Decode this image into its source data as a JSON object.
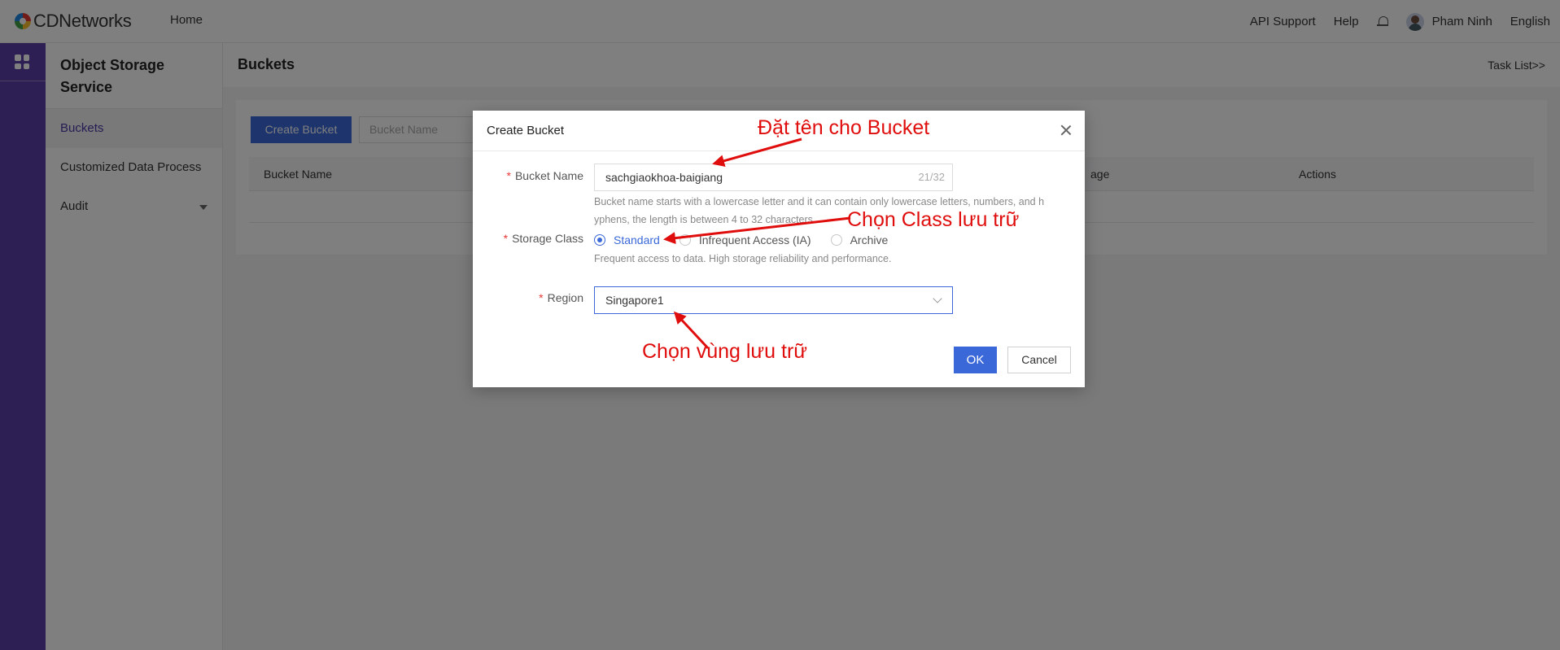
{
  "topbar": {
    "logo_text": "CDNetworks",
    "home_label": "Home",
    "api_support": "API Support",
    "help": "Help",
    "user_name": "Pham Ninh",
    "language": "English"
  },
  "sidebar": {
    "title": "Object Storage Service",
    "items": [
      {
        "label": "Buckets"
      },
      {
        "label": "Customized Data Process"
      },
      {
        "label": "Audit"
      }
    ]
  },
  "main": {
    "title": "Buckets",
    "task_list": "Task List>>",
    "create_bucket_label": "Create Bucket",
    "search_placeholder": "Bucket Name",
    "columns": {
      "bucket_name": "Bucket Name",
      "storage_partial": "age",
      "actions": "Actions"
    }
  },
  "modal": {
    "title": "Create Bucket",
    "bucket_name_label": "Bucket Name",
    "bucket_name_value": "sachgiaokhoa-baigiang",
    "bucket_name_counter": "21/32",
    "bucket_name_hint_1": "Bucket name starts with a lowercase letter and it can contain only lowercase letters, numbers, and h",
    "bucket_name_hint_2": "yphens, the length is between 4 to 32 characters.",
    "storage_class_label": "Storage Class",
    "storage_options": [
      {
        "label": "Standard",
        "selected": true
      },
      {
        "label": "Infrequent Access (IA)",
        "selected": false
      },
      {
        "label": "Archive",
        "selected": false
      }
    ],
    "storage_hint": "Frequent access to data. High storage reliability and performance.",
    "region_label": "Region",
    "region_value": "Singapore1",
    "ok_label": "OK",
    "cancel_label": "Cancel"
  },
  "annotations": {
    "bucket_name_note": "Đặt tên cho Bucket",
    "storage_class_note": "Chọn Class lưu trữ",
    "region_note": "Chọn vùng lưu trữ",
    "color": "#e00d0d"
  },
  "colors": {
    "accent": "#3b68d8",
    "rail": "#5b3fa8",
    "required": "#e53935"
  }
}
